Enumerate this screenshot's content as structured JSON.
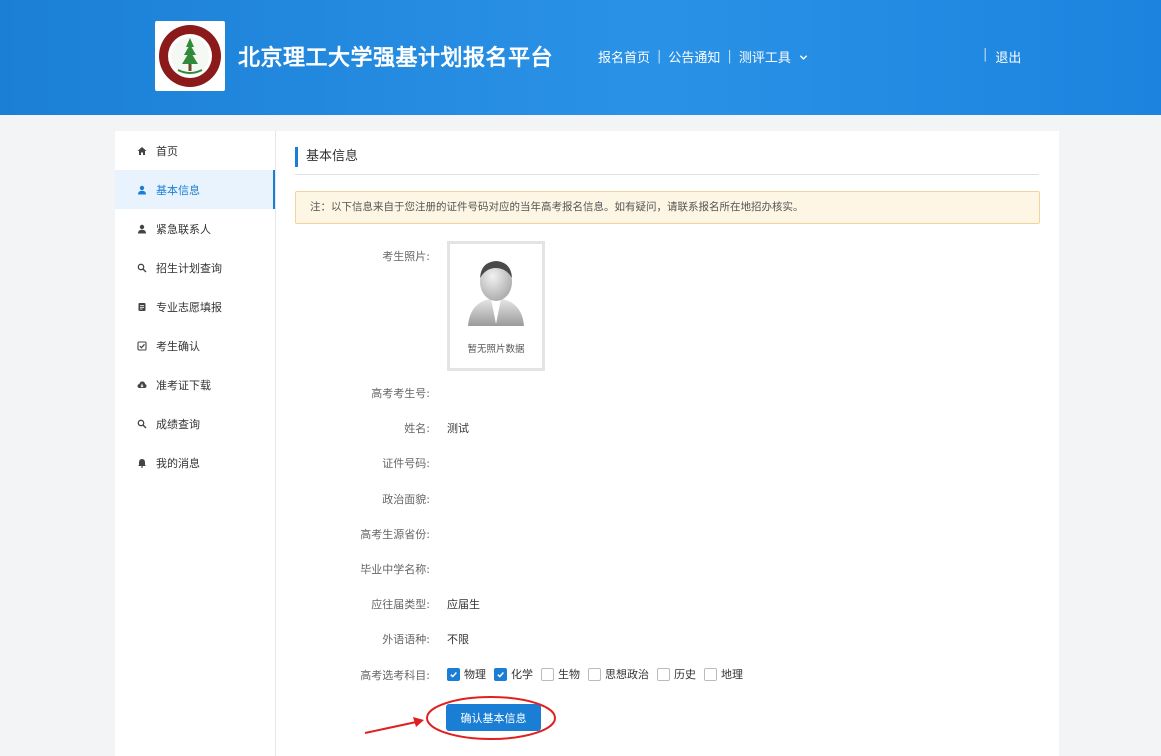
{
  "header": {
    "title": "北京理工大学强基计划报名平台",
    "nav": [
      "报名首页",
      "公告通知",
      "测评工具"
    ],
    "logout": "退出"
  },
  "sidebar": {
    "items": [
      {
        "label": "首页",
        "icon": "home-icon"
      },
      {
        "label": "基本信息",
        "icon": "user-icon",
        "active": true
      },
      {
        "label": "紧急联系人",
        "icon": "user-icon"
      },
      {
        "label": "招生计划查询",
        "icon": "search-icon"
      },
      {
        "label": "专业志愿填报",
        "icon": "document-icon"
      },
      {
        "label": "考生确认",
        "icon": "checkbox-icon"
      },
      {
        "label": "准考证下载",
        "icon": "cloud-download-icon"
      },
      {
        "label": "成绩查询",
        "icon": "search-icon"
      },
      {
        "label": "我的消息",
        "icon": "bell-icon"
      }
    ]
  },
  "main": {
    "section_title": "基本信息",
    "notice": "注：以下信息来自于您注册的证件号码对应的当年高考报名信息。如有疑问，请联系报名所在地招办核实。",
    "photo": {
      "label": "考生照片:",
      "caption": "暂无照片数据"
    },
    "fields": [
      {
        "label": "高考考生号:",
        "value": ""
      },
      {
        "label": "姓名:",
        "value": "测试"
      },
      {
        "label": "证件号码:",
        "value": ""
      },
      {
        "label": "政治面貌:",
        "value": ""
      },
      {
        "label": "高考生源省份:",
        "value": ""
      },
      {
        "label": "毕业中学名称:",
        "value": ""
      },
      {
        "label": "应往届类型:",
        "value": "应届生"
      },
      {
        "label": "外语语种:",
        "value": "不限"
      }
    ],
    "subjects_label": "高考选考科目:",
    "subjects": [
      {
        "name": "物理",
        "checked": true
      },
      {
        "name": "化学",
        "checked": true
      },
      {
        "name": "生物",
        "checked": false
      },
      {
        "name": "思想政治",
        "checked": false
      },
      {
        "name": "历史",
        "checked": false
      },
      {
        "name": "地理",
        "checked": false
      }
    ],
    "confirm_button": "确认基本信息"
  },
  "colors": {
    "primary": "#1a7fd4",
    "annotation": "#e02020"
  }
}
